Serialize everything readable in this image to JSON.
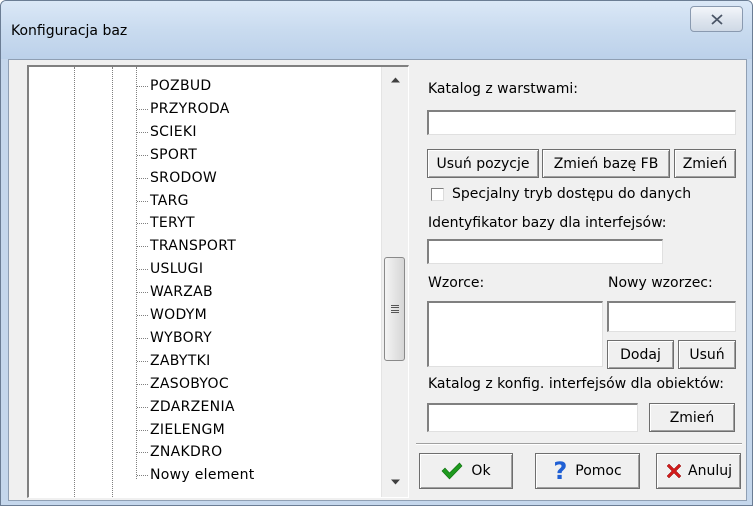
{
  "window": {
    "title": "Konfiguracja baz"
  },
  "tree": {
    "items": [
      {
        "label": "POZBUD"
      },
      {
        "label": "PRZYRODA"
      },
      {
        "label": "SCIEKI"
      },
      {
        "label": "SPORT"
      },
      {
        "label": "SRODOW"
      },
      {
        "label": "TARG"
      },
      {
        "label": "TERYT"
      },
      {
        "label": "TRANSPORT"
      },
      {
        "label": "USLUGI"
      },
      {
        "label": "WARZAB"
      },
      {
        "label": "WODYM"
      },
      {
        "label": "WYBORY"
      },
      {
        "label": "ZABYTKI"
      },
      {
        "label": "ZASOBYOC"
      },
      {
        "label": "ZDARZENIA"
      },
      {
        "label": "ZIELENGM"
      },
      {
        "label": "ZNAKDRO"
      },
      {
        "label": "Nowy element"
      }
    ]
  },
  "form": {
    "catalog_label": "Katalog z warstwami:",
    "catalog_value": "",
    "remove_positions_button": "Usuń pozycje",
    "change_fb_button": "Zmień bazę FB",
    "change_button": "Zmień",
    "special_mode_checkbox_label": "Specjalny tryb dostępu do danych",
    "special_mode_checked": false,
    "identifier_label": "Identyfikator bazy dla interfejsów:",
    "identifier_value": "",
    "patterns_label": "Wzorce:",
    "new_pattern_label": "Nowy wzorzec:",
    "new_pattern_value": "",
    "add_button": "Dodaj",
    "remove_button": "Usuń",
    "interfaces_catalog_label": "Katalog z konfig. interfejsów dla obiektów:",
    "interfaces_catalog_value": "",
    "interfaces_change_button": "Zmień"
  },
  "footer": {
    "ok_button": "Ok",
    "help_button": "Pomoc",
    "cancel_button": "Anuluj",
    "ok_icon": "checkmark-icon",
    "help_icon": "question-mark-icon",
    "cancel_icon": "red-x-icon"
  },
  "colors": {
    "ok_icon": "#1e9a1e",
    "help_icon": "#1f5fd4",
    "cancel_icon": "#d11a1a"
  }
}
